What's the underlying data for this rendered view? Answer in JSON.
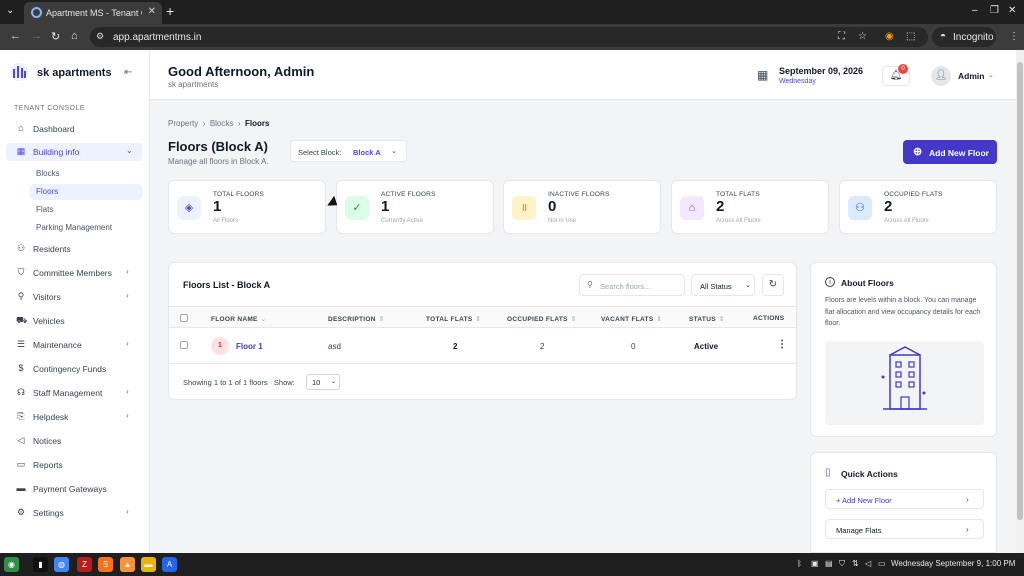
{
  "browser": {
    "tab_title": "Apartment MS - Tenant Co",
    "url": "app.apartmentms.in",
    "incognito_label": "Incognito"
  },
  "sidebar": {
    "brand": "sk apartments",
    "section_label": "TENANT CONSOLE",
    "items": [
      {
        "label": "Dashboard",
        "icon": "home-icon"
      },
      {
        "label": "Building info",
        "icon": "grid-icon"
      },
      {
        "label": "Residents",
        "icon": "users-icon"
      },
      {
        "label": "Committee Members",
        "icon": "shield-icon"
      },
      {
        "label": "Visitors",
        "icon": "user-plus-icon"
      },
      {
        "label": "Vehicles",
        "icon": "car-icon"
      },
      {
        "label": "Maintenance",
        "icon": "tool-icon"
      },
      {
        "label": "Contingency Funds",
        "icon": "dollar-icon"
      },
      {
        "label": "Staff Management",
        "icon": "headset-icon"
      },
      {
        "label": "Helpdesk",
        "icon": "ticket-icon"
      },
      {
        "label": "Notices",
        "icon": "megaphone-icon"
      },
      {
        "label": "Reports",
        "icon": "file-icon"
      },
      {
        "label": "Payment Gateways",
        "icon": "card-icon"
      },
      {
        "label": "Settings",
        "icon": "gear-icon"
      }
    ],
    "subitems": [
      "Blocks",
      "Floors",
      "Flats",
      "Parking Management"
    ]
  },
  "header": {
    "greeting": "Good Afternoon, Admin",
    "subtitle": "sk apartments",
    "date": "September 09, 2026",
    "weekday": "Wednesday",
    "notification_count": "0",
    "user": "Admin"
  },
  "breadcrumb": [
    "Property",
    "Blocks",
    "Floors"
  ],
  "page": {
    "title": "Floors (Block A)",
    "subtitle": "Manage all floors in Block A.",
    "select_label": "Select Block:",
    "select_value": "Block A",
    "add_button": "Add New Floor"
  },
  "stats": [
    {
      "label": "TOTAL FLOORS",
      "value": "1",
      "note": "All Floors",
      "color": "#4f46e5"
    },
    {
      "label": "ACTIVE FLOORS",
      "value": "1",
      "note": "Currently Active",
      "color": "#16a34a"
    },
    {
      "label": "INACTIVE FLOORS",
      "value": "0",
      "note": "Not in Use",
      "color": "#d97706"
    },
    {
      "label": "TOTAL FLATS",
      "value": "2",
      "note": "Across All Floors",
      "color": "#9333ea"
    },
    {
      "label": "OCCUPIED FLATS",
      "value": "2",
      "note": "Across All Floors",
      "color": "#2563eb"
    }
  ],
  "list": {
    "title": "Floors List - Block A",
    "search_placeholder": "Search floors...",
    "status_filter": "All Status",
    "columns": [
      "FLOOR NAME",
      "DESCRIPTION",
      "TOTAL FLATS",
      "OCCUPIED FLATS",
      "VACANT FLATS",
      "STATUS",
      "ACTIONS"
    ],
    "rows": [
      {
        "num": "1",
        "name": "Floor 1",
        "description": "asd",
        "total": "2",
        "occupied": "2",
        "vacant": "0",
        "status": "Active"
      }
    ],
    "footer": "Showing 1 to 1 of 1 floors",
    "show_label": "Show:",
    "page_size": "10"
  },
  "about": {
    "title": "About Floors",
    "text": "Floors are levels within a block. You can manage flat allocation and view occupancy details for each floor."
  },
  "quick": {
    "title": "Quick Actions",
    "actions": [
      "+ Add New Floor",
      "Manage Flats"
    ]
  },
  "taskbar": {
    "clock": "Wednesday September 9, 1:00 PM"
  },
  "colors": {
    "accent": "#4338ca",
    "brand": "#4f46e5"
  }
}
